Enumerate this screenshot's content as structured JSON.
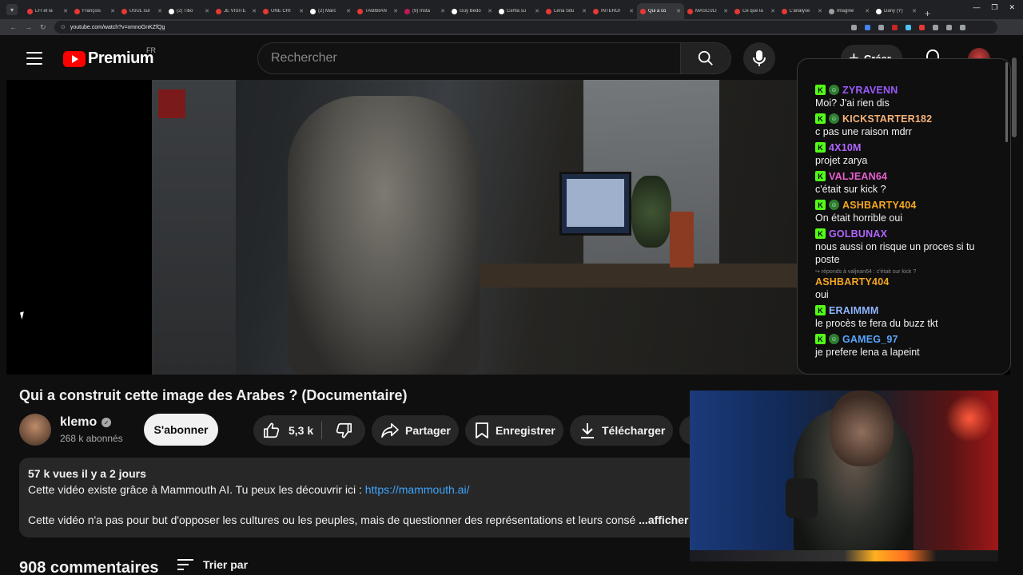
{
  "browser": {
    "tabs": [
      {
        "label": "LFI et la",
        "color": "#e53935"
      },
      {
        "label": "François",
        "color": "#e53935"
      },
      {
        "label": "USUL sur",
        "color": "#e53935"
      },
      {
        "label": "(2) Tibo",
        "color": "#ffffff"
      },
      {
        "label": "JE VISITE",
        "color": "#e53935"
      },
      {
        "label": "UNE CRI",
        "color": "#e53935"
      },
      {
        "label": "(2) Marc",
        "color": "#ffffff"
      },
      {
        "label": "TABIBIAN",
        "color": "#e53935"
      },
      {
        "label": "(9) Insta",
        "color": "#c2185b"
      },
      {
        "label": "Guy Bedo",
        "color": "#ffffff"
      },
      {
        "label": "Cerfia su",
        "color": "#ffffff"
      },
      {
        "label": "Lena Situ",
        "color": "#e53935"
      },
      {
        "label": "INTERDI",
        "color": "#e53935"
      },
      {
        "label": "Qui a co",
        "color": "#e53935",
        "active": true
      },
      {
        "label": "MASCULI",
        "color": "#e53935"
      },
      {
        "label": "Ce que la",
        "color": "#e53935"
      },
      {
        "label": "L'analyse",
        "color": "#e53935"
      },
      {
        "label": "Imagine",
        "color": "#9e9e9e"
      },
      {
        "label": "Dany (Y)",
        "color": "#ffffff"
      }
    ],
    "new_tab": "+",
    "url": "youtube.com/watch?v=xmnoGnKZfQg"
  },
  "header": {
    "logo_text": "Premium",
    "region": "FR",
    "search_placeholder": "Rechercher",
    "create_label": "Créer"
  },
  "chat": {
    "messages": [
      {
        "user": "ZYRAVENN",
        "color": "#9b59ff",
        "face": true,
        "text": "Moi? J'ai rien dis"
      },
      {
        "user": "KICKSTARTER182",
        "color": "#f5b27a",
        "face": true,
        "text": "c pas une raison mdrr"
      },
      {
        "user": "4X10M",
        "color": "#b266ff",
        "face": false,
        "text": "projet zarya"
      },
      {
        "user": "VALJEAN64",
        "color": "#e95fd0",
        "face": false,
        "text": "c'était sur kick ?"
      },
      {
        "user": "ASHBARTY404",
        "color": "#f5a623",
        "face": true,
        "text": "On était horrible oui"
      },
      {
        "user": "GOLBUNAX",
        "color": "#b266ff",
        "face": false,
        "text": "nous aussi on risque un proces si tu poste"
      },
      {
        "user": "ASHBARTY404",
        "color": "#f5a623",
        "face": false,
        "reply": "↪ réponds à valjean64 : c'était sur kick ?",
        "text": "oui",
        "no_badge": true
      },
      {
        "user": "ERAIMMM",
        "color": "#8fb5ff",
        "face": false,
        "text": "le procès te fera du buzz tkt"
      },
      {
        "user": "GAMEG_97",
        "color": "#5aa5ff",
        "face": true,
        "text": "je prefere lena a lapeint"
      }
    ]
  },
  "video": {
    "title": "Qui a construit cette image des Arabes ? (Documentaire)",
    "channel_name": "klemo",
    "subscribers": "268 k abonnés",
    "subscribe_label": "S'abonner",
    "likes": "5,3 k",
    "share_label": "Partager",
    "save_label": "Enregistrer",
    "download_label": "Télécharger"
  },
  "description": {
    "meta": "57 k vues  il y a 2 jours",
    "line1_prefix": "Cette vidéo existe grâce à Mammouth AI. Tu peux les découvrir ici : ",
    "link": "https://mammouth.ai/",
    "line2": "Cette vidéo n'a pas pour but d'opposer les cultures ou les peuples, mais de questionner des représentations et leurs consé",
    "more": " ...afficher plus"
  },
  "comments": {
    "count": "908 commentaires",
    "sort_label": "Trier par"
  },
  "colors": {
    "accent": "#ff0000",
    "link": "#3ea6ff",
    "kick_green": "#53fc18"
  }
}
